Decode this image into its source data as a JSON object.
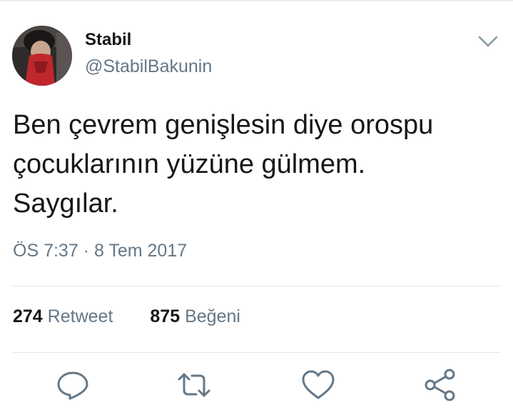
{
  "author": {
    "name": "Stabil",
    "handle": "@StabilBakunin"
  },
  "tweet": {
    "lines": [
      "Ben çevrem genişlesin diye orospu",
      "çocuklarının yüzüne gülmem.",
      "Saygılar."
    ],
    "timestamp": "ÖS 7:37 · 8 Tem 2017"
  },
  "stats": {
    "retweet_count": "274",
    "retweet_label": "Retweet",
    "like_count": "875",
    "like_label": "Beğeni"
  },
  "icons": {
    "menu": "chevron-down-icon",
    "reply": "reply-icon",
    "retweet": "retweet-icon",
    "like": "heart-icon",
    "share": "share-icon"
  },
  "colors": {
    "icon": "#657786",
    "text": "#14171a",
    "muted": "#657786",
    "divider": "#e1e8ed"
  }
}
